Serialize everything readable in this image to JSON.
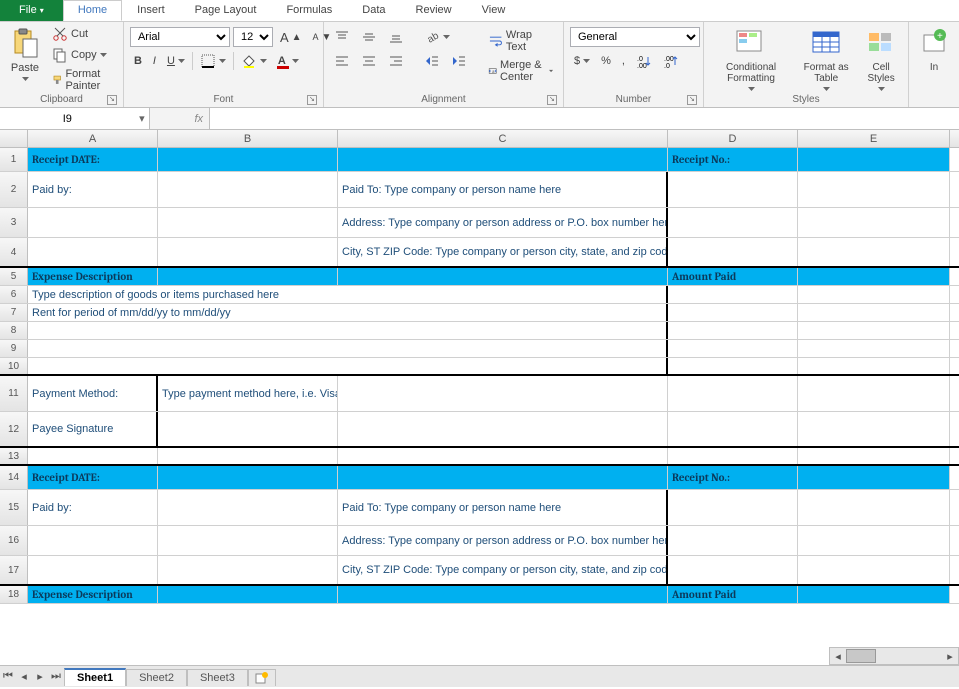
{
  "tabs": {
    "file": "File",
    "home": "Home",
    "insert": "Insert",
    "page_layout": "Page Layout",
    "formulas": "Formulas",
    "data": "Data",
    "review": "Review",
    "view": "View"
  },
  "clipboard": {
    "paste": "Paste",
    "cut": "Cut",
    "copy": "Copy",
    "format_painter": "Format Painter",
    "group": "Clipboard"
  },
  "font": {
    "name": "Arial",
    "size": "12",
    "bold": "B",
    "italic": "I",
    "underline": "U",
    "group": "Font"
  },
  "alignment": {
    "wrap": "Wrap Text",
    "merge": "Merge & Center",
    "group": "Alignment"
  },
  "number": {
    "format": "General",
    "currency": "$",
    "percent": "%",
    "comma": ",",
    "group": "Number"
  },
  "styles": {
    "cond": "Conditional Formatting",
    "table": "Format as Table",
    "cell": "Cell Styles",
    "group": "Styles",
    "insert": "In"
  },
  "namebox": "I9",
  "fx": "fx",
  "columns": [
    "A",
    "B",
    "C",
    "D",
    "E"
  ],
  "rows": {
    "1": {
      "h": "norm",
      "blue": true,
      "A": "Receipt DATE:",
      "D": "Receipt No.:"
    },
    "2": {
      "h": "tall",
      "A": "Paid by:",
      "C": "Paid To:  Type company or person name here"
    },
    "3": {
      "h": "med",
      "C": "Address:  Type company or person address or P.O. box number here"
    },
    "4": {
      "h": "med",
      "C": "City, ST  ZIP Code:  Type company or person city, state, and zip code here"
    },
    "5": {
      "h": "short",
      "blue": true,
      "A": "Expense Description",
      "D": "Amount Paid"
    },
    "6": {
      "h": "short",
      "A": "Type description of goods or items purchased here"
    },
    "7": {
      "h": "short",
      "A": "Rent for period of mm/dd/yy to mm/dd/yy",
      "between": "7-8"
    },
    "8": {
      "h": "short"
    },
    "9": {
      "h": "short",
      "selrow": true
    },
    "10": {
      "h": "short"
    },
    "11": {
      "h": "tall",
      "A": "Payment Method:",
      "B": "Type payment method here, i.e. Visa, MasterCard, check, cash, and so on"
    },
    "12": {
      "h": "tall",
      "A": "Payee Signature"
    },
    "13": {
      "h": "short"
    },
    "14": {
      "h": "norm",
      "blue": true,
      "A": "Receipt DATE:",
      "D": "Receipt No.:"
    },
    "15": {
      "h": "tall",
      "A": "Paid by:",
      "C": "Paid To:  Type company or person name here"
    },
    "16": {
      "h": "med",
      "C": "Address:  Type company or person address or P.O. box number here"
    },
    "17": {
      "h": "med",
      "C": "City, ST  ZIP Code:  Type company or person city, state, and zip code here"
    },
    "18": {
      "h": "short",
      "blue": true,
      "A": "Expense Description",
      "D": "Amount Paid"
    }
  },
  "sheets": {
    "s1": "Sheet1",
    "s2": "Sheet2",
    "s3": "Sheet3"
  }
}
